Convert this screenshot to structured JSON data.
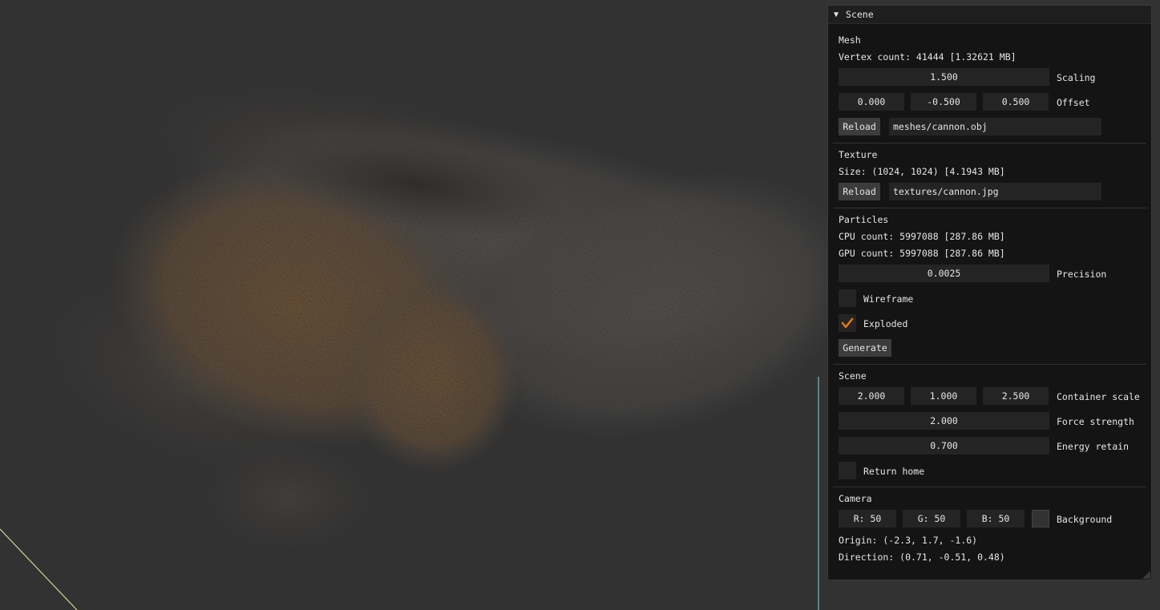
{
  "window": {
    "title": "Scene",
    "collapse_icon": "triangle-down-icon"
  },
  "mesh": {
    "heading": "Mesh",
    "vertex_count": "Vertex count: 41444 [1.32621 MB]",
    "scaling_value": "1.500",
    "scaling_label": "Scaling",
    "offset_x": "0.000",
    "offset_y": "-0.500",
    "offset_z": "0.500",
    "offset_label": "Offset",
    "reload_label": "Reload",
    "path": "meshes/cannon.obj"
  },
  "texture": {
    "heading": "Texture",
    "size": "Size: (1024, 1024) [4.1943 MB]",
    "reload_label": "Reload",
    "path": "textures/cannon.jpg"
  },
  "particles": {
    "heading": "Particles",
    "cpu_count": "CPU count: 5997088 [287.86 MB]",
    "gpu_count": "GPU count: 5997088 [287.86 MB]",
    "precision_value": "0.0025",
    "precision_label": "Precision",
    "wireframe_label": "Wireframe",
    "wireframe_checked": false,
    "exploded_label": "Exploded",
    "exploded_checked": true,
    "generate_label": "Generate"
  },
  "scene": {
    "heading": "Scene",
    "container_x": "2.000",
    "container_y": "1.000",
    "container_z": "2.500",
    "container_label": "Container scale",
    "force_value": "2.000",
    "force_label": "Force strength",
    "energy_value": "0.700",
    "energy_label": "Energy retain",
    "return_home_label": "Return home",
    "return_home_checked": false
  },
  "camera": {
    "heading": "Camera",
    "r": "R: 50",
    "g": "G: 50",
    "b": "B: 50",
    "background_label": "Background",
    "background_color": "#323232",
    "origin": "Origin: (-2.3, 1.7, -1.6)",
    "direction": "Direction: (0.71, -0.51, 0.48)"
  },
  "colors": {
    "viewport_bg": "#323232",
    "panel_bg": "#141414",
    "field_bg": "#242424",
    "button_bg": "#3c3c3c",
    "check_mark": "#e07a10",
    "particles_warm": "#b0763a",
    "particles_gray": "#6e6a66"
  }
}
